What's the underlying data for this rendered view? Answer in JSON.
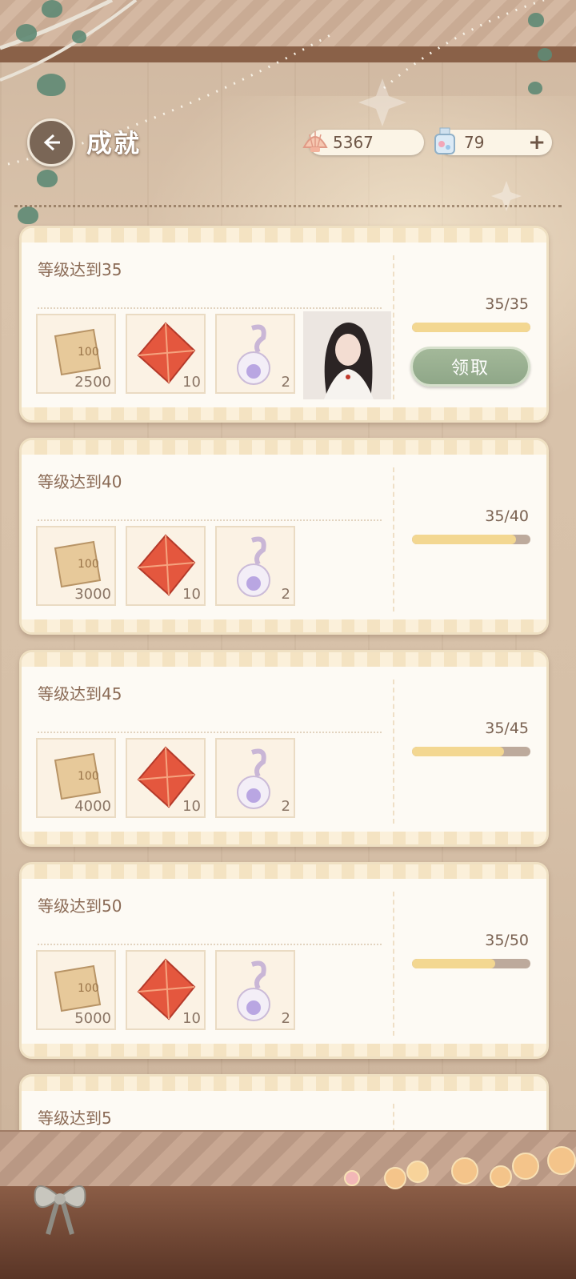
{
  "header": {
    "title": "成就",
    "currencies": [
      {
        "icon": "shell-icon",
        "value": "5367"
      },
      {
        "icon": "bottle-icon",
        "value": "79",
        "action": "+"
      }
    ]
  },
  "achievements": [
    {
      "title": "等级达到35",
      "progress": "35/35",
      "ratio": 1.0,
      "rewards": [
        {
          "icon": "ticket-icon",
          "qty": "2500"
        },
        {
          "icon": "crystal-icon",
          "qty": "10"
        },
        {
          "icon": "pearl-bottle-icon",
          "qty": "2"
        }
      ],
      "portrait": true,
      "claim_label": "领取"
    },
    {
      "title": "等级达到40",
      "progress": "35/40",
      "ratio": 0.875,
      "rewards": [
        {
          "icon": "ticket-icon",
          "qty": "3000"
        },
        {
          "icon": "crystal-icon",
          "qty": "10"
        },
        {
          "icon": "pearl-bottle-icon",
          "qty": "2"
        }
      ]
    },
    {
      "title": "等级达到45",
      "progress": "35/45",
      "ratio": 0.778,
      "rewards": [
        {
          "icon": "ticket-icon",
          "qty": "4000"
        },
        {
          "icon": "crystal-icon",
          "qty": "10"
        },
        {
          "icon": "pearl-bottle-icon",
          "qty": "2"
        }
      ]
    },
    {
      "title": "等级达到50",
      "progress": "35/50",
      "ratio": 0.7,
      "rewards": [
        {
          "icon": "ticket-icon",
          "qty": "5000"
        },
        {
          "icon": "crystal-icon",
          "qty": "10"
        },
        {
          "icon": "pearl-bottle-icon",
          "qty": "2"
        }
      ]
    },
    {
      "title": "等级达到5"
    }
  ]
}
